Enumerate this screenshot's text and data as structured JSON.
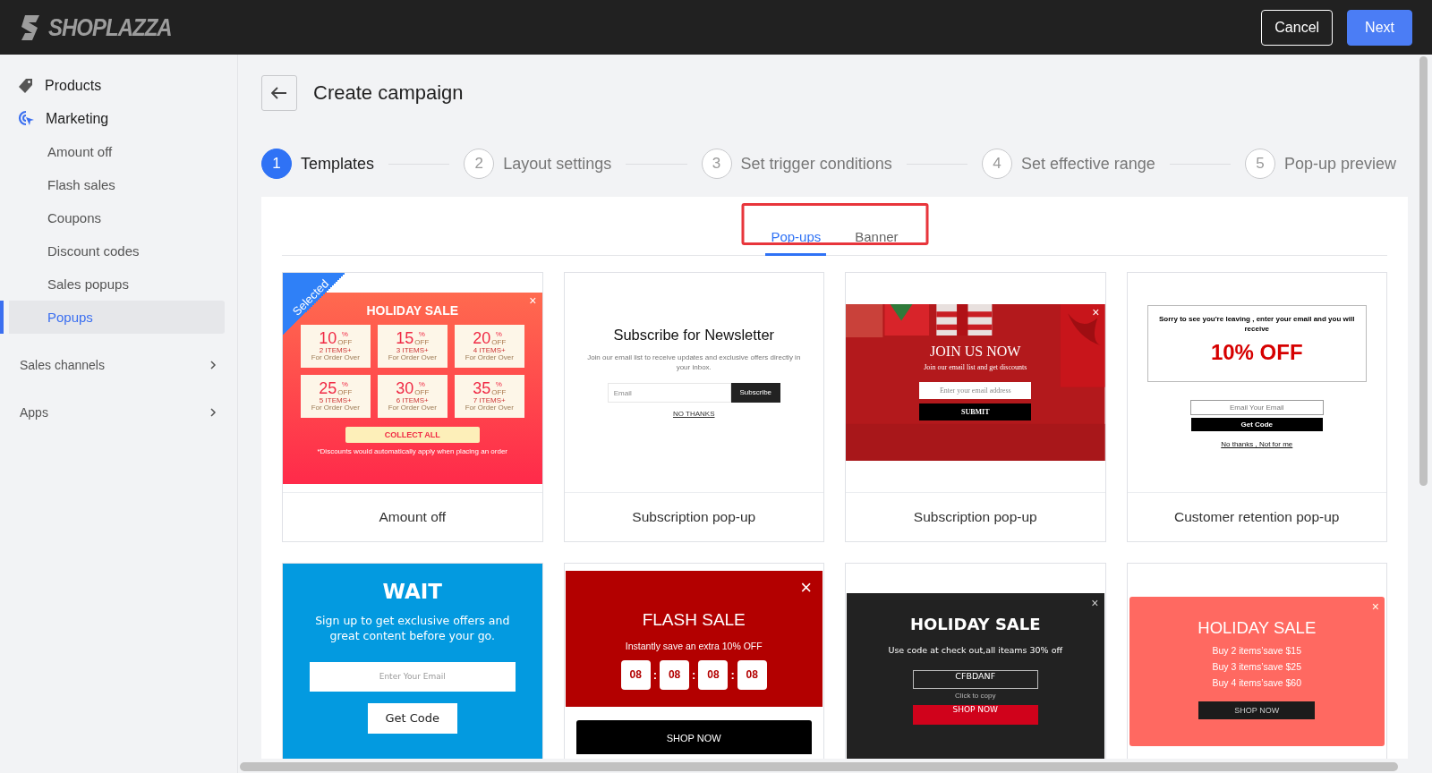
{
  "header": {
    "logo": "SHOPLAZZA",
    "buttons": [
      {
        "label": "Cancel",
        "kind": "secondary"
      },
      {
        "label": "Next",
        "kind": "primary"
      }
    ]
  },
  "sidebar": {
    "items": [
      {
        "label": "Products",
        "kind": "main",
        "active": false,
        "selected": false
      },
      {
        "label": "Marketing",
        "kind": "main",
        "active": true,
        "selected": false
      },
      {
        "label": "Amount off",
        "kind": "sub",
        "selected": false
      },
      {
        "label": "Flash sales",
        "kind": "sub",
        "selected": false
      },
      {
        "label": "Coupons",
        "kind": "sub",
        "selected": false
      },
      {
        "label": "Discount codes",
        "kind": "sub",
        "selected": false
      },
      {
        "label": "Sales popups",
        "kind": "sub",
        "selected": false
      },
      {
        "label": "Popups",
        "kind": "sub",
        "selected": true
      },
      {
        "label": "Sales channels",
        "kind": "group",
        "expanded": false,
        "selected": false
      },
      {
        "label": "Apps",
        "kind": "group",
        "expanded": false,
        "selected": false
      }
    ]
  },
  "page": {
    "title": "Create campaign",
    "steps": [
      {
        "number": "1",
        "label": "Templates",
        "selected": true
      },
      {
        "number": "2",
        "label": "Layout settings",
        "selected": false
      },
      {
        "number": "3",
        "label": "Set trigger conditions",
        "selected": false
      },
      {
        "number": "4",
        "label": "Set effective range",
        "selected": false
      },
      {
        "number": "5",
        "label": "Pop-up preview",
        "selected": false
      }
    ],
    "tabs": [
      {
        "label": "Pop-ups",
        "selected": true
      },
      {
        "label": "Banner",
        "selected": false
      }
    ],
    "templates": [
      {
        "caption": "Amount off",
        "selected": true,
        "badge": "Selected",
        "preview": {
          "kind": "coupons",
          "close": "×",
          "title": "HOLIDAY SALE",
          "coupons": [
            {
              "percent": "10",
              "unit": "%",
              "off": "OFF",
              "items": "2 ITEMS+",
              "note": "For Order Over"
            },
            {
              "percent": "15",
              "unit": "%",
              "off": "OFF",
              "items": "3 ITEMS+",
              "note": "For Order Over"
            },
            {
              "percent": "20",
              "unit": "%",
              "off": "OFF",
              "items": "4 ITEMS+",
              "note": "For Order Over"
            },
            {
              "percent": "25",
              "unit": "%",
              "off": "OFF",
              "items": "5 ITEMS+",
              "note": "For Order Over"
            },
            {
              "percent": "30",
              "unit": "%",
              "off": "OFF",
              "items": "6 ITEMS+",
              "note": "For Order Over"
            },
            {
              "percent": "35",
              "unit": "%",
              "off": "OFF",
              "items": "7 ITEMS+",
              "note": "For Order Over"
            }
          ],
          "button": "COLLECT ALL",
          "footnote": "*Discounts would automatically apply  when placing an order"
        }
      },
      {
        "caption": "Subscription pop-up",
        "selected": false,
        "preview": {
          "kind": "newsletter",
          "title": "Subscribe for Newsletter",
          "text": "Join our email list to receive updates and exclusive offers directly in your inbox.",
          "placeholder": "Email",
          "button": "Subscribe",
          "link": "NO THANKS"
        }
      },
      {
        "caption": "Subscription pop-up",
        "selected": false,
        "preview": {
          "close": "×",
          "title": "JOIN US NOW",
          "text": "Join our email list and get discounts",
          "placeholder": "Enter your email address",
          "button": "SUBMIT"
        }
      },
      {
        "caption": "Customer retention pop-up",
        "selected": false,
        "preview": {
          "kind": "retention",
          "text": "Sorry to see you're leaving , enter your email and you will receive",
          "offer": "10% OFF",
          "placeholder": "Email Your Email",
          "button": "Get Code",
          "link": "No thanks , Not for me"
        }
      },
      {
        "selected": false,
        "preview": {
          "kind": "wait",
          "title": "WAIT",
          "text": "Sign up to get exclusive offers and great content before your go.",
          "placeholder": "Enter Your Email",
          "button": "Get Code"
        }
      },
      {
        "selected": false,
        "preview": {
          "kind": "countdown",
          "close": "×",
          "title": "FLASH SALE",
          "text": "Instantly save an extra 10% OFF",
          "digits": [
            "08",
            "08",
            "08",
            "08"
          ],
          "separator": ":",
          "button": "SHOP NOW"
        }
      },
      {
        "selected": false,
        "preview": {
          "kind": "code",
          "close": "×",
          "title": "HOLIDAY SALE",
          "text": "Use code at check out,all iteams 30% off",
          "code": "CFBDANF",
          "hint": "Click to copy",
          "button": "SHOP NOW"
        }
      },
      {
        "selected": false,
        "preview": {
          "kind": "offers",
          "close": "×",
          "title": "HOLIDAY SALE",
          "lines": [
            "Buy 2 items’save $15",
            "Buy 3 items’save $25",
            "Buy 4 items’save $60"
          ],
          "button": "SHOP NOW"
        }
      }
    ]
  }
}
